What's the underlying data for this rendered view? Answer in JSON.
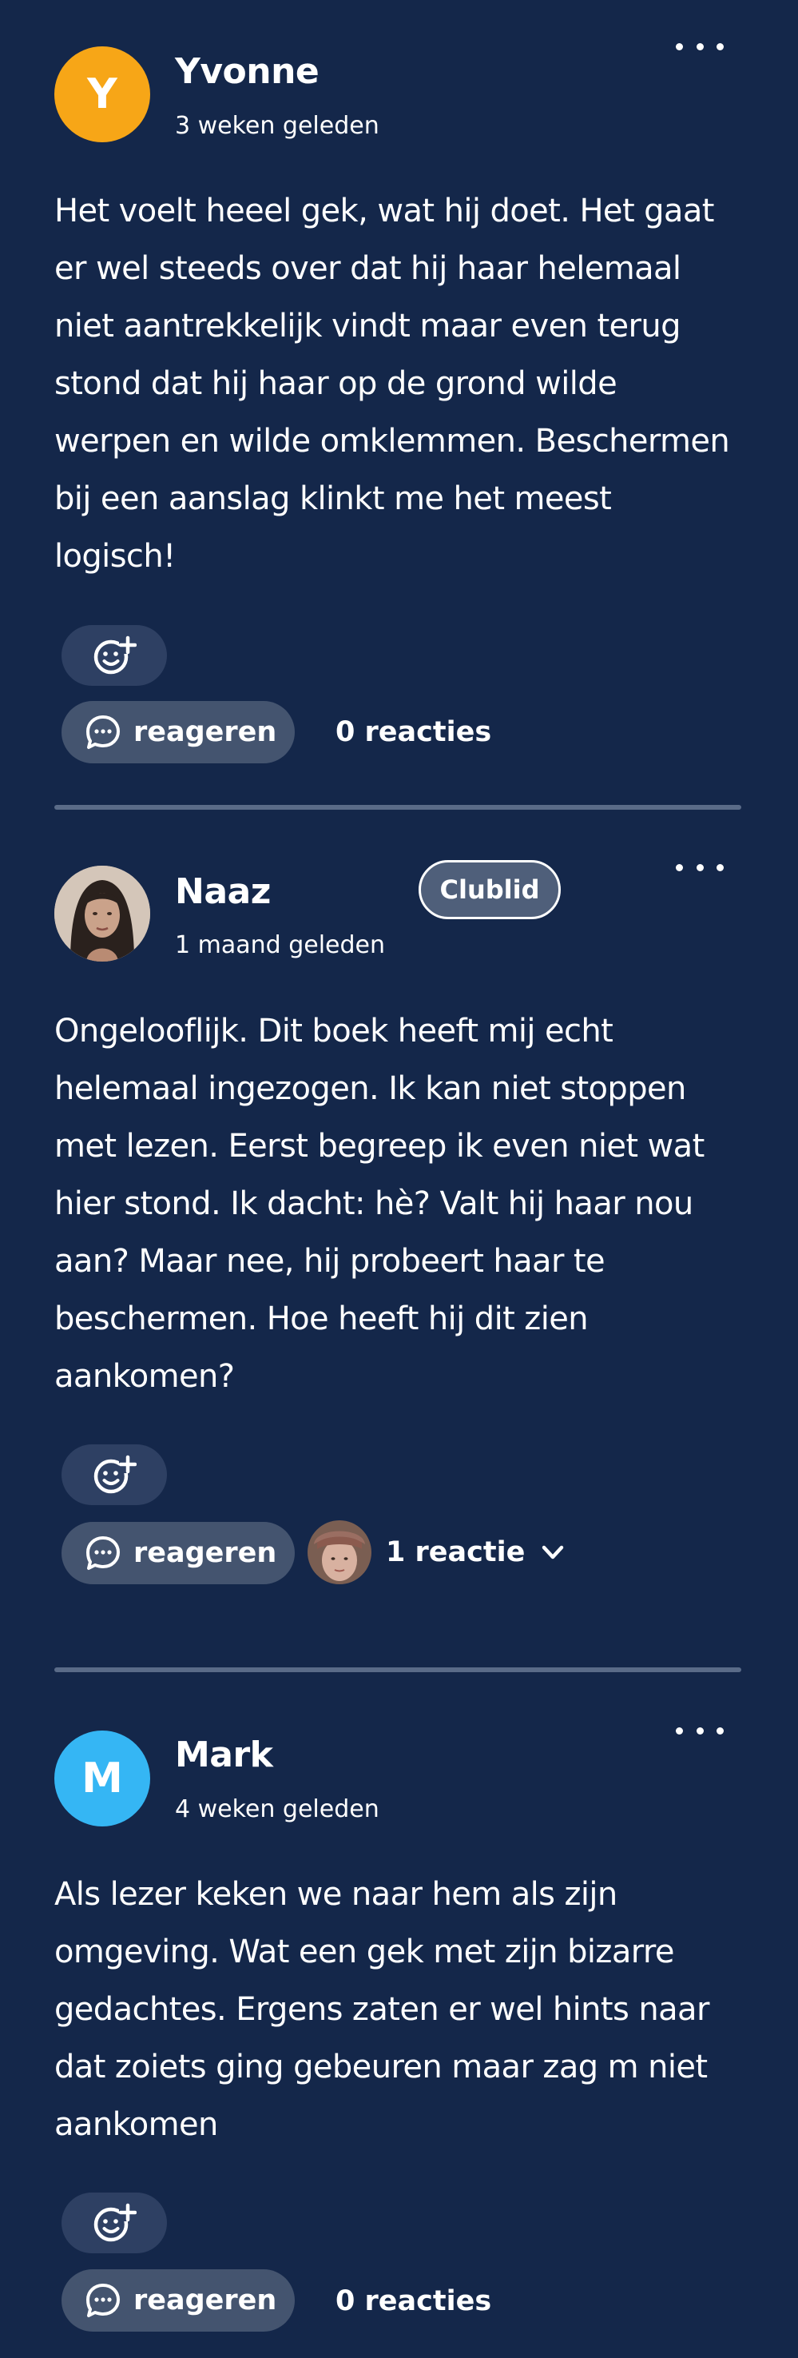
{
  "comments": [
    {
      "author": "Yvonne",
      "avatar_initial": "Y",
      "avatar_color": "#f7a617",
      "time": "3 weken geleden",
      "text": "Het voelt heeel gek, wat hij doet. Het gaat er wel steeds over dat hij haar helemaal niet aantrekkelijk vindt maar even terug stond dat hij haar op de grond wilde werpen en wilde omklemmen. Beschermen bij een aanslag klinkt me het meest logisch!",
      "reply_label": "reageren",
      "reactions": "0 reacties"
    },
    {
      "author": "Naaz",
      "badge": "Clublid",
      "avatar_icon": "user-photo-icon",
      "time": "1 maand geleden",
      "text": "Ongelooflijk. Dit boek heeft mij echt helemaal ingezogen. Ik kan niet stoppen met lezen. Eerst begreep ik even niet wat hier stond. Ik dacht: hè? Valt hij haar nou aan? Maar nee, hij probeert haar te beschermen. Hoe heeft hij dit zien aankomen?",
      "reply_label": "reageren",
      "reactions": "1 reactie"
    },
    {
      "author": "Mark",
      "avatar_initial": "M",
      "avatar_color": "#35b6f4",
      "time": "4 weken geleden",
      "text": "Als lezer keken we naar hem als zijn omgeving. Wat een gek met zijn bizarre gedachtes. Ergens zaten er wel hints naar dat zoiets ging gebeuren maar zag m niet aankomen",
      "reply_label": "reageren",
      "reactions": "0 reacties"
    }
  ],
  "icons": {
    "more": "more-options-icon",
    "add_reaction": "add-emoji-reaction-icon",
    "reply": "chat-bubble-icon",
    "expand": "chevron-down-icon"
  },
  "colors": {
    "background": "#14274a",
    "reply_button": "#44546f",
    "reaction_button": "#2e4063",
    "divider": "#5a6b88"
  }
}
